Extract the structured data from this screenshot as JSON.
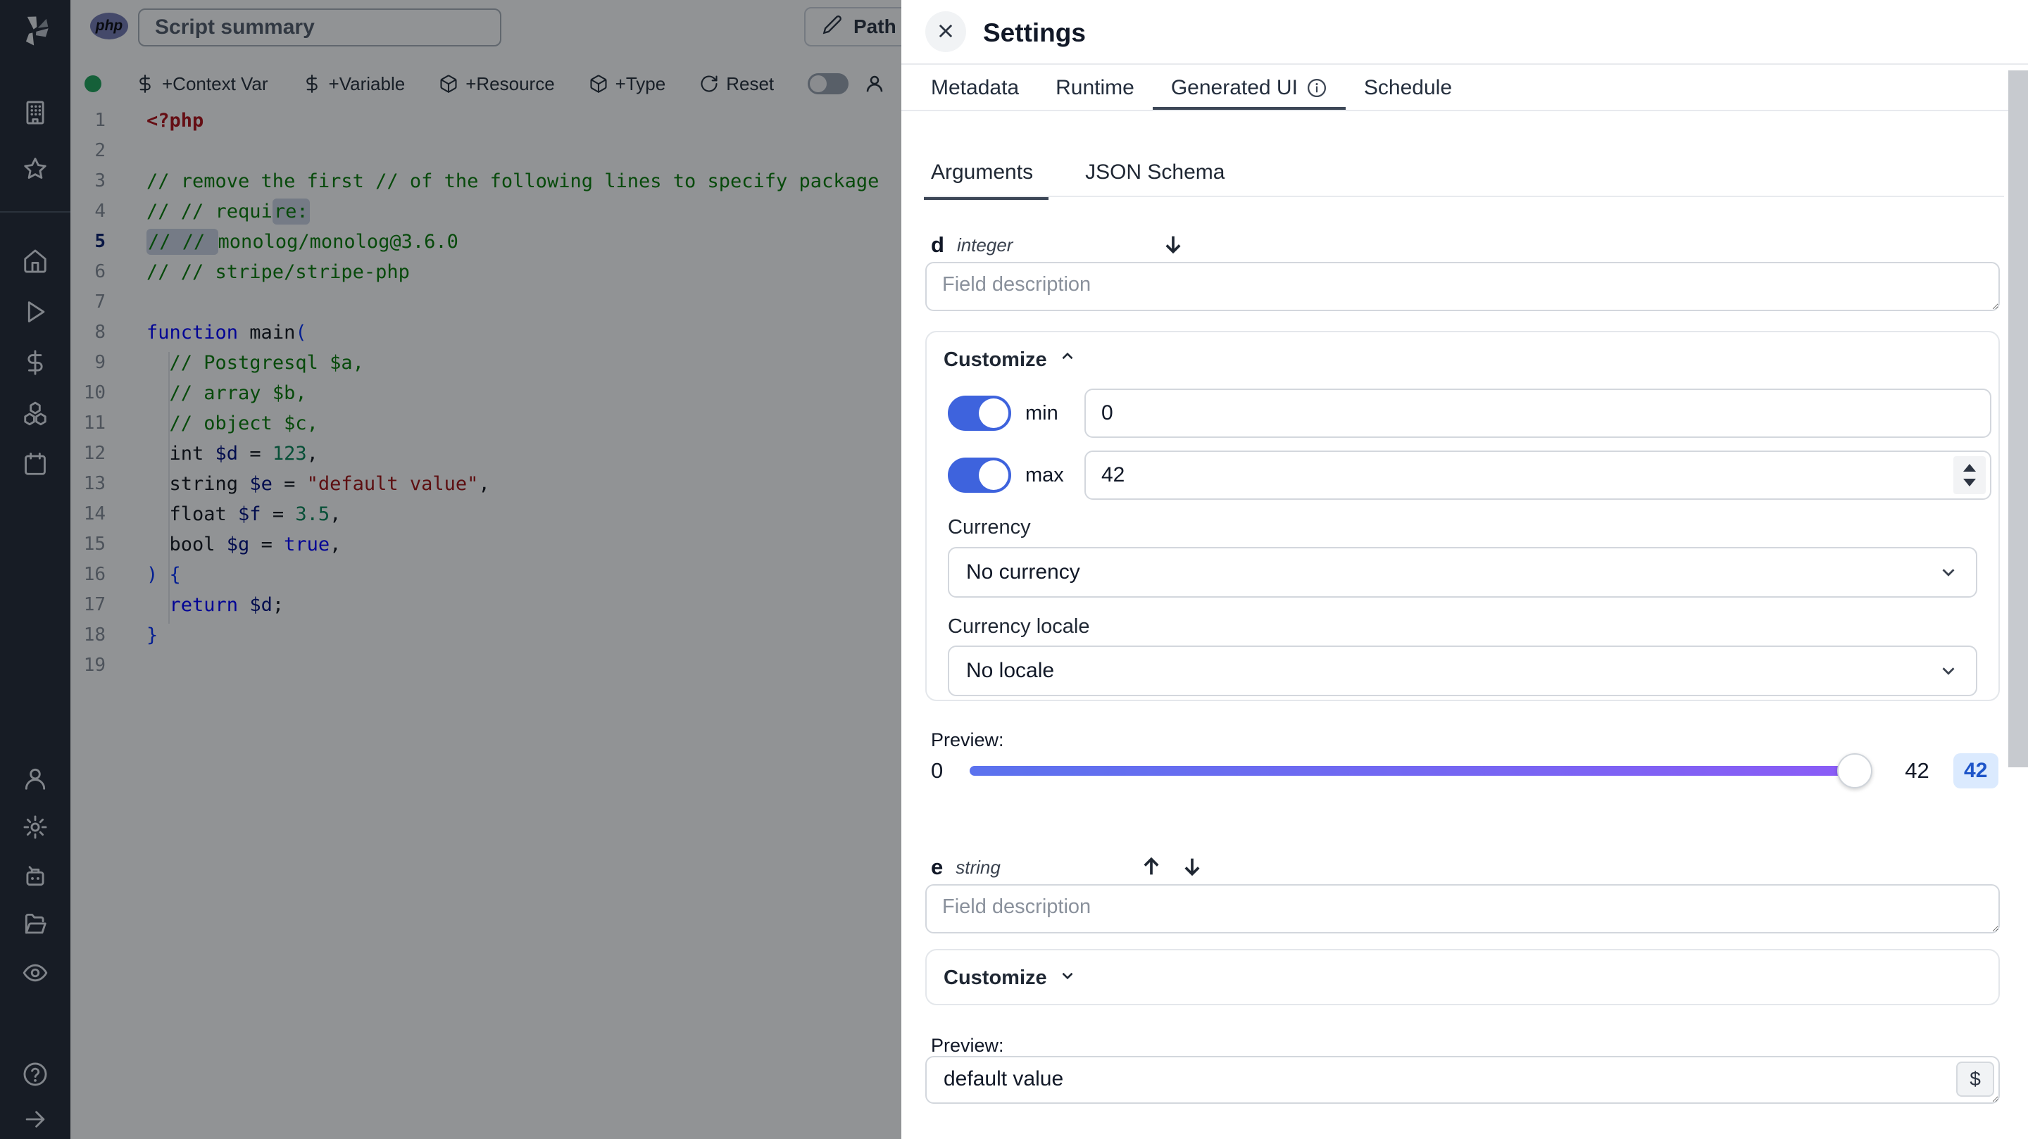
{
  "topbar": {
    "language_badge": "php",
    "summary_placeholder": "Script summary",
    "path_button_label": "Path"
  },
  "toolbar": {
    "buttons": [
      {
        "icon": "dollar-icon",
        "label": "+Context Var"
      },
      {
        "icon": "dollar-icon",
        "label": "+Variable"
      },
      {
        "icon": "package-icon",
        "label": "+Resource"
      },
      {
        "icon": "package-icon",
        "label": "+Type"
      },
      {
        "icon": "refresh-icon",
        "label": "Reset"
      }
    ]
  },
  "sidebar": {
    "top_icons": [
      "building",
      "star"
    ],
    "main_icons": [
      "home",
      "play",
      "dollar",
      "boxes",
      "calendar"
    ],
    "lower_icons": [
      "user",
      "settings",
      "robot",
      "folder-open",
      "eye"
    ],
    "footer_icons": [
      "help",
      "arrow-right"
    ]
  },
  "editor": {
    "lines": [
      {
        "n": 1,
        "tokens": [
          {
            "c": "meta",
            "t": "<?php"
          }
        ]
      },
      {
        "n": 2,
        "tokens": []
      },
      {
        "n": 3,
        "tokens": [
          {
            "c": "cm",
            "t": "// remove the first // of the following lines to specify package"
          }
        ]
      },
      {
        "n": 4,
        "tokens": [
          {
            "c": "cm",
            "t": "// // requi"
          },
          {
            "c": "cm",
            "t": "re:",
            "sel": true
          }
        ]
      },
      {
        "n": 5,
        "tokens": [
          {
            "c": "cm",
            "t": "// // ",
            "sel": true
          },
          {
            "c": "cm",
            "t": "monolog/monolog@3.6.0"
          }
        ],
        "active": true
      },
      {
        "n": 6,
        "tokens": [
          {
            "c": "cm",
            "t": "// // stripe/stripe-php"
          }
        ]
      },
      {
        "n": 7,
        "tokens": []
      },
      {
        "n": 8,
        "tokens": [
          {
            "c": "kw",
            "t": "function"
          },
          {
            "c": "def",
            "t": " main"
          },
          {
            "c": "br",
            "t": "("
          }
        ]
      },
      {
        "n": 9,
        "tokens": [
          {
            "c": "def",
            "t": "  "
          },
          {
            "c": "cm",
            "t": "// Postgresql $a,"
          }
        ]
      },
      {
        "n": 10,
        "tokens": [
          {
            "c": "def",
            "t": "  "
          },
          {
            "c": "cm",
            "t": "// array $b,"
          }
        ]
      },
      {
        "n": 11,
        "tokens": [
          {
            "c": "def",
            "t": "  "
          },
          {
            "c": "cm",
            "t": "// object $c,"
          }
        ]
      },
      {
        "n": 12,
        "tokens": [
          {
            "c": "def",
            "t": "  int "
          },
          {
            "c": "var",
            "t": "$d"
          },
          {
            "c": "def",
            "t": " = "
          },
          {
            "c": "num",
            "t": "123"
          },
          {
            "c": "def",
            "t": ","
          }
        ]
      },
      {
        "n": 13,
        "tokens": [
          {
            "c": "def",
            "t": "  string "
          },
          {
            "c": "var",
            "t": "$e"
          },
          {
            "c": "def",
            "t": " = "
          },
          {
            "c": "str",
            "t": "\"default value\""
          },
          {
            "c": "def",
            "t": ","
          }
        ]
      },
      {
        "n": 14,
        "tokens": [
          {
            "c": "def",
            "t": "  float "
          },
          {
            "c": "var",
            "t": "$f"
          },
          {
            "c": "def",
            "t": " = "
          },
          {
            "c": "num",
            "t": "3.5"
          },
          {
            "c": "def",
            "t": ","
          }
        ]
      },
      {
        "n": 15,
        "tokens": [
          {
            "c": "def",
            "t": "  bool "
          },
          {
            "c": "var",
            "t": "$g"
          },
          {
            "c": "def",
            "t": " = "
          },
          {
            "c": "kw",
            "t": "true"
          },
          {
            "c": "def",
            "t": ","
          }
        ]
      },
      {
        "n": 16,
        "tokens": [
          {
            "c": "br",
            "t": ") {"
          }
        ]
      },
      {
        "n": 17,
        "tokens": [
          {
            "c": "def",
            "t": "  "
          },
          {
            "c": "kw",
            "t": "return"
          },
          {
            "c": "def",
            "t": " "
          },
          {
            "c": "var",
            "t": "$d"
          },
          {
            "c": "def",
            "t": ";"
          }
        ]
      },
      {
        "n": 18,
        "tokens": [
          {
            "c": "br",
            "t": "}"
          }
        ]
      },
      {
        "n": 19,
        "tokens": []
      }
    ]
  },
  "settings": {
    "title": "Settings",
    "tabs": [
      {
        "label": "Metadata"
      },
      {
        "label": "Runtime"
      },
      {
        "label": "Generated UI",
        "active": true,
        "info": true
      },
      {
        "label": "Schedule"
      }
    ],
    "subtabs": [
      {
        "label": "Arguments",
        "active": true
      },
      {
        "label": "JSON Schema"
      }
    ],
    "field_d": {
      "name": "d",
      "type": "integer",
      "description_placeholder": "Field description",
      "customize_label": "Customize",
      "min_label": "min",
      "min_value": "0",
      "max_label": "max",
      "max_value": "42",
      "currency_label": "Currency",
      "currency_value": "No currency",
      "locale_label": "Currency locale",
      "locale_value": "No locale",
      "preview_label": "Preview:",
      "slider_min": "0",
      "slider_max": "42",
      "slider_value": "42"
    },
    "field_e": {
      "name": "e",
      "type": "string",
      "description_placeholder": "Field description",
      "customize_label": "Customize",
      "preview_label": "Preview:",
      "preview_value": "default value",
      "variable_button": "$"
    }
  },
  "colors": {
    "toggle_on": "#3e63dd",
    "slider_from": "#5b72ee",
    "slider_to": "#8b5cf6",
    "badge_bg": "#dbeafe",
    "badge_text": "#1e55c9",
    "status_dot": "#22a55b",
    "php_badge": "#777bb3"
  }
}
